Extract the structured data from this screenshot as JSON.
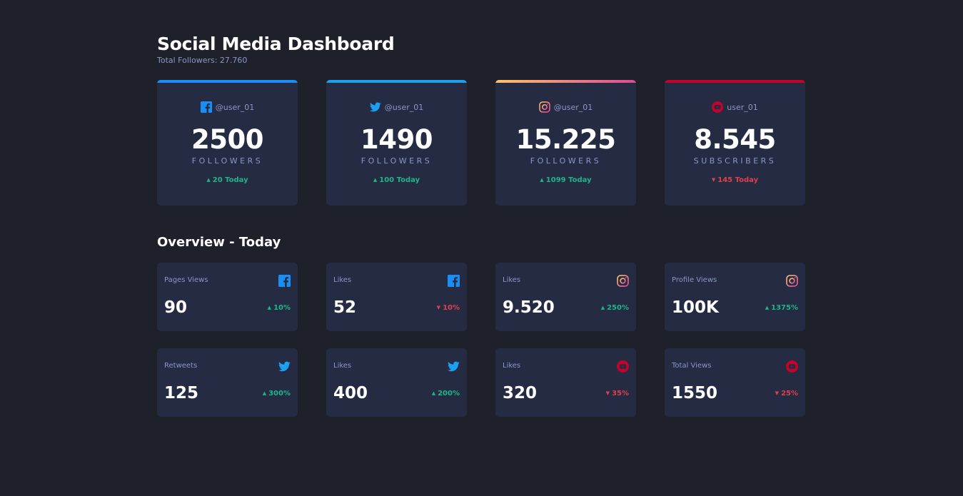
{
  "header": {
    "title": "Social Media Dashboard",
    "total_followers": "Total Followers: 27.760"
  },
  "colors": {
    "background": "#1e202a",
    "card": "#252b43",
    "muted_text": "#8b97c6",
    "up": "#1eb589",
    "down": "#dc414c",
    "facebook": "#198ff5",
    "twitter": "#1ca0f2",
    "youtube": "#c4032b",
    "instagram_gradient": [
      "#fdc468",
      "#df4996"
    ]
  },
  "cards": [
    {
      "platform": "facebook",
      "icon": "facebook-icon",
      "handle": "@user_01",
      "count": "2500",
      "unit": "FOLLOWERS",
      "change": "20 Today",
      "trend": "up"
    },
    {
      "platform": "twitter",
      "icon": "twitter-icon",
      "handle": "@user_01",
      "count": "1490",
      "unit": "FOLLOWERS",
      "change": "100 Today",
      "trend": "up"
    },
    {
      "platform": "instagram",
      "icon": "instagram-icon",
      "handle": "@user_01",
      "count": "15.225",
      "unit": "FOLLOWERS",
      "change": "1099 Today",
      "trend": "up"
    },
    {
      "platform": "youtube",
      "icon": "youtube-icon",
      "handle": "user_01",
      "count": "8.545",
      "unit": "SUBSCRIBERS",
      "change": "145 Today",
      "trend": "down"
    }
  ],
  "overview": {
    "title": "Overview - Today",
    "items": [
      {
        "label": "Pages Views",
        "platform": "facebook",
        "icon": "facebook-icon",
        "value": "90",
        "change": "10%",
        "trend": "up"
      },
      {
        "label": "Likes",
        "platform": "facebook",
        "icon": "facebook-icon",
        "value": "52",
        "change": "10%",
        "trend": "down"
      },
      {
        "label": "Likes",
        "platform": "instagram",
        "icon": "instagram-icon",
        "value": "9.520",
        "change": "250%",
        "trend": "up"
      },
      {
        "label": "Profile Views",
        "platform": "instagram",
        "icon": "instagram-icon",
        "value": "100K",
        "change": "1375%",
        "trend": "up"
      },
      {
        "label": "Retweets",
        "platform": "twitter",
        "icon": "twitter-icon",
        "value": "125",
        "change": "300%",
        "trend": "up"
      },
      {
        "label": "Likes",
        "platform": "twitter",
        "icon": "twitter-icon",
        "value": "400",
        "change": "200%",
        "trend": "up"
      },
      {
        "label": "Likes",
        "platform": "youtube",
        "icon": "youtube-icon",
        "value": "320",
        "change": "35%",
        "trend": "down"
      },
      {
        "label": "Total Views",
        "platform": "youtube",
        "icon": "youtube-icon",
        "value": "1550",
        "change": "25%",
        "trend": "down"
      }
    ]
  }
}
